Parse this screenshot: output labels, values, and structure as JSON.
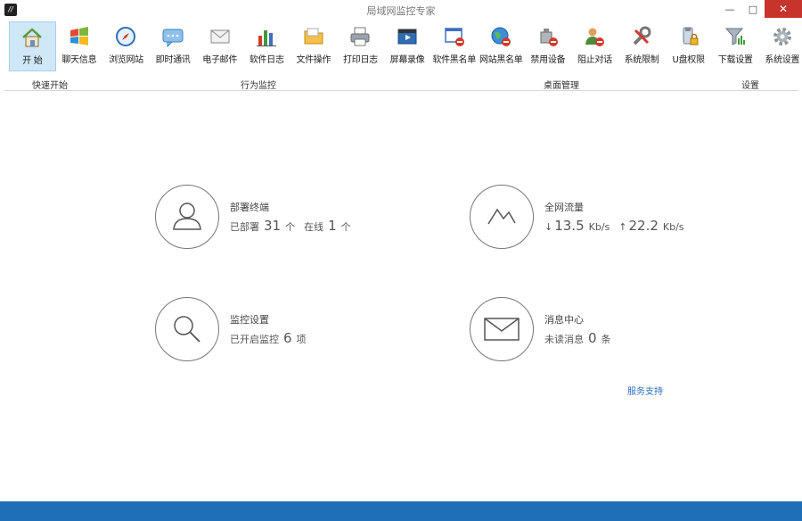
{
  "window": {
    "title": "局域网监控专家",
    "app_icon_glyph": "//",
    "buttons": [
      "—",
      "□",
      "✕"
    ]
  },
  "toolbar": {
    "items": [
      {
        "label": "开 始",
        "icon": "home-icon"
      },
      {
        "label": "聊天信息",
        "icon": "windows-flag-icon"
      },
      {
        "label": "浏览网站",
        "icon": "compass-icon"
      },
      {
        "label": "即时通讯",
        "icon": "chat-bubble-icon"
      },
      {
        "label": "电子邮件",
        "icon": "envelope-icon"
      },
      {
        "label": "软件日志",
        "icon": "bar-chart-icon"
      },
      {
        "label": "文件操作",
        "icon": "folder-icon"
      },
      {
        "label": "打印日志",
        "icon": "printer-icon"
      },
      {
        "label": "屏幕录像",
        "icon": "film-icon"
      },
      {
        "label": "软件黑名单",
        "icon": "window-block-icon"
      },
      {
        "label": "网站黑名单",
        "icon": "globe-block-icon"
      },
      {
        "label": "禁用设备",
        "icon": "device-block-icon"
      },
      {
        "label": "阻止对话",
        "icon": "user-block-icon"
      },
      {
        "label": "系统限制",
        "icon": "tools-icon"
      },
      {
        "label": "U盘权限",
        "icon": "usb-lock-icon"
      },
      {
        "label": "下载设置",
        "icon": "download-icon"
      },
      {
        "label": "系统设置",
        "icon": "gear-icon"
      }
    ],
    "groups": [
      "快速开始",
      "行为监控",
      "桌面管理",
      "设置"
    ],
    "accent": "#cfe8f8"
  },
  "dashboard": {
    "terminals": {
      "title": "部署终端",
      "deployed_label": "已部署",
      "deployed": "31",
      "unit": "个",
      "online_label": "在线",
      "online": "1",
      "online_unit": "个"
    },
    "traffic": {
      "title": "全网流量",
      "down": "13.5",
      "up": "22.2",
      "unit": "Kb/s",
      "down_arrow": "↓",
      "up_arrow": "↑"
    },
    "monitor": {
      "title": "监控设置",
      "enabled_label": "已开启监控",
      "count": "6",
      "unit": "项"
    },
    "messages": {
      "title": "消息中心",
      "unread_label": "未读消息",
      "count": "0",
      "unit": "条"
    },
    "support_link": "服务支持"
  },
  "footer_color": "#1f6fb8"
}
